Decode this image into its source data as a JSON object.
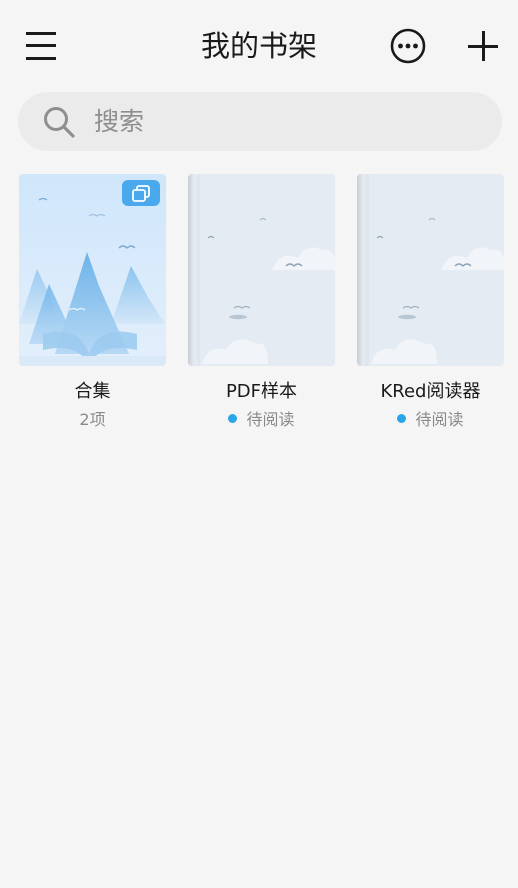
{
  "header": {
    "title": "我的书架",
    "menu_icon": "hamburger-menu-icon",
    "more_icon": "more-options-icon",
    "add_icon": "plus-icon"
  },
  "search": {
    "placeholder": "搜索",
    "icon": "search-icon"
  },
  "books": [
    {
      "name": "合集",
      "subtitle": "2项",
      "type": "collection",
      "badge_icon": "collection-stack-icon"
    },
    {
      "name": "PDF样本",
      "subtitle": "待阅读",
      "status_dot": true,
      "type": "book"
    },
    {
      "name": "KRed阅读器",
      "subtitle": "待阅读",
      "status_dot": true,
      "type": "book"
    }
  ],
  "colors": {
    "background": "#f5f5f5",
    "search_bg": "#ebebeb",
    "accent_dot": "#2aa6e8",
    "badge": "#4aa8ec"
  }
}
